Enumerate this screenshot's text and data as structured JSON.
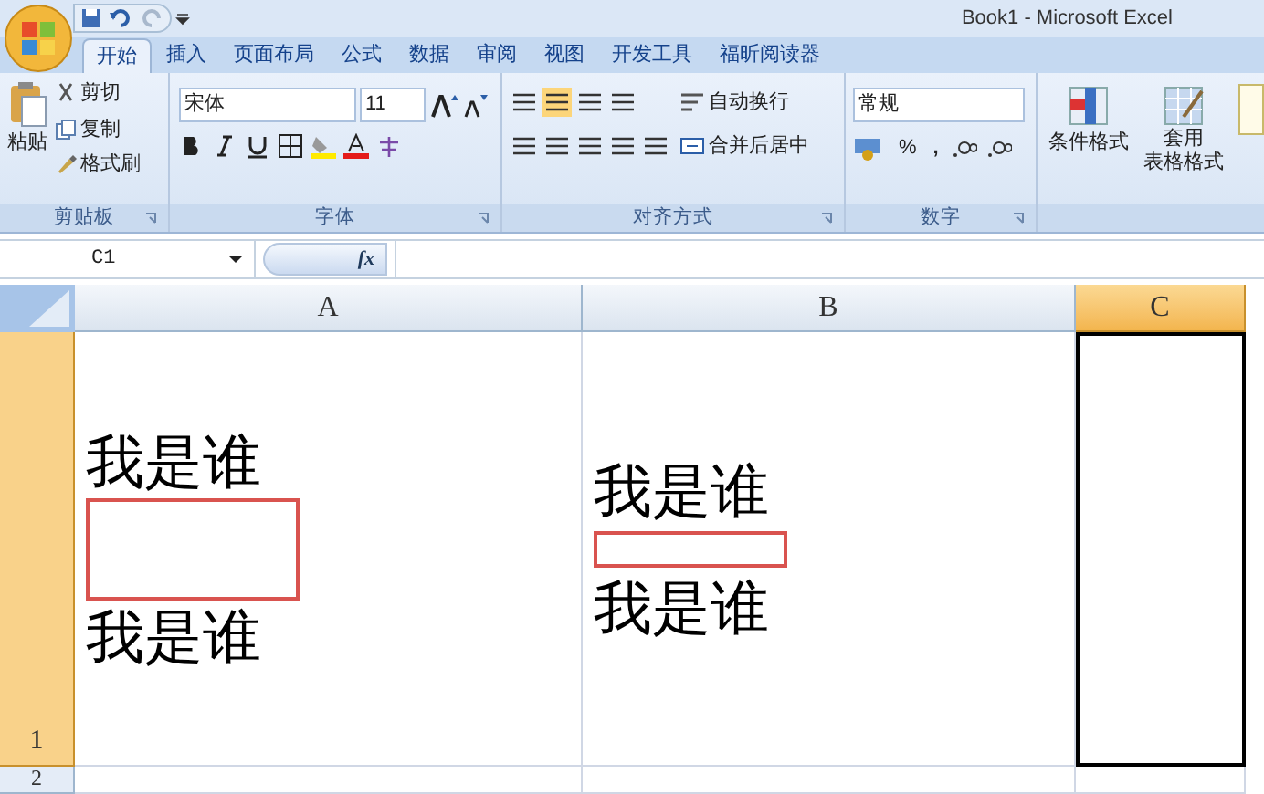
{
  "window": {
    "title": "Book1 - Microsoft Excel"
  },
  "tabs": [
    {
      "label": "开始",
      "selected": true
    },
    {
      "label": "插入",
      "selected": false
    },
    {
      "label": "页面布局",
      "selected": false
    },
    {
      "label": "公式",
      "selected": false
    },
    {
      "label": "数据",
      "selected": false
    },
    {
      "label": "审阅",
      "selected": false
    },
    {
      "label": "视图",
      "selected": false
    },
    {
      "label": "开发工具",
      "selected": false
    },
    {
      "label": "福昕阅读器",
      "selected": false
    }
  ],
  "clipboard": {
    "paste": "粘贴",
    "cut": "剪切",
    "copy": "复制",
    "format_painter": "格式刷",
    "label": "剪贴板"
  },
  "font": {
    "name": "宋体",
    "size": "11",
    "label": "字体"
  },
  "alignment": {
    "wrap": "自动换行",
    "merge": "合并后居中",
    "label": "对齐方式"
  },
  "number": {
    "format": "常规",
    "percent": "%",
    "comma": ",",
    "label": "数字"
  },
  "styles": {
    "conditional": "条件格式",
    "table_line1": "套用",
    "table_line2": "表格格式"
  },
  "formula_bar": {
    "name_box": "C1",
    "fx": "fx"
  },
  "columns": [
    {
      "label": "A",
      "selected": false
    },
    {
      "label": "B",
      "selected": false
    },
    {
      "label": "C",
      "selected": true
    }
  ],
  "rows": [
    {
      "label": "1",
      "selected": true
    },
    {
      "label": "2",
      "selected": false
    }
  ],
  "cells": [
    {
      "items": [
        {
          "kind": "text",
          "text": "我是谁"
        },
        {
          "kind": "box"
        },
        {
          "kind": "text",
          "text": "我是谁"
        }
      ]
    },
    {
      "items": [
        {
          "kind": "text",
          "text": "我是谁"
        },
        {
          "kind": "thin-box"
        },
        {
          "kind": "text",
          "text": "我是谁"
        }
      ]
    }
  ]
}
